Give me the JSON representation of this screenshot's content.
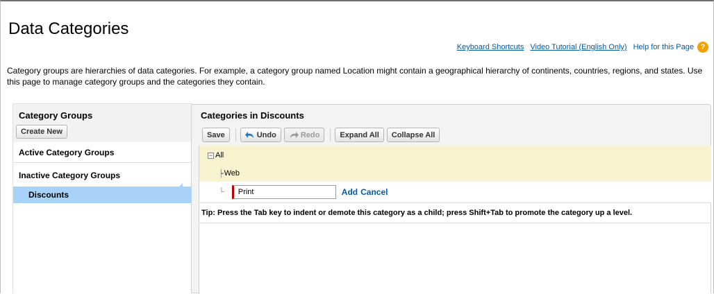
{
  "page": {
    "title": "Data Categories",
    "description": "Category groups are hierarchies of data categories. For example, a category group named Location might contain a geographical hierarchy of continents, countries, regions, and states. Use this page to manage category groups and the categories they contain."
  },
  "help_links": {
    "keyboard_shortcuts": "Keyboard Shortcuts",
    "video_tutorial": "Video Tutorial (English Only)",
    "help_page": "Help for this Page",
    "help_icon": "?"
  },
  "left_panel": {
    "title": "Category Groups",
    "create_new_label": "Create New",
    "active_groups_label": "Active Category Groups",
    "inactive_groups_label": "Inactive Category Groups",
    "selected_group": "Discounts"
  },
  "right_panel": {
    "title": "Categories in Discounts",
    "toolbar": {
      "save": "Save",
      "undo": "Undo",
      "redo": "Redo",
      "expand_all": "Expand All",
      "collapse_all": "Collapse All"
    },
    "tree": {
      "root": "All",
      "children": [
        "Web"
      ],
      "new_category_value": "Print",
      "add_label": "Add",
      "cancel_label": "Cancel"
    },
    "tip": "Tip: Press the Tab key to indent or demote this category as a child; press Shift+Tab to promote the category up a level."
  },
  "colors": {
    "link": "#015ba7",
    "selected_row": "#a8d3f8",
    "tree_highlight": "#f7f3cf",
    "help_icon": "#f2a100",
    "required_marker": "#c00000"
  }
}
